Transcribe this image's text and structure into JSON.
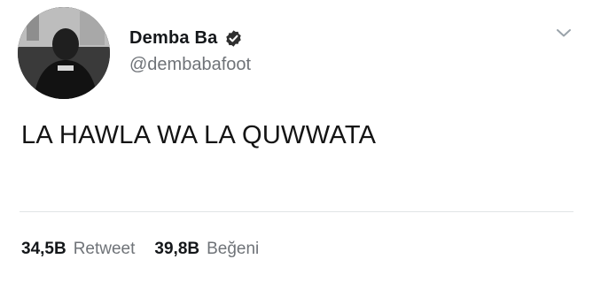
{
  "user": {
    "display_name": "Demba Ba",
    "handle": "@dembabafoot",
    "verified": true
  },
  "tweet": {
    "text": "LA HAWLA WA LA QUWWATA"
  },
  "stats": {
    "retweets_count": "34,5B",
    "retweets_label": "Retweet",
    "likes_count": "39,8B",
    "likes_label": "Beğeni"
  },
  "icons": {
    "verified": "verified-badge-icon",
    "menu": "chevron-down-icon"
  },
  "colors": {
    "verified_badge": "#2f2f2f",
    "text": "#14171a",
    "secondary_text": "#6f7378"
  }
}
